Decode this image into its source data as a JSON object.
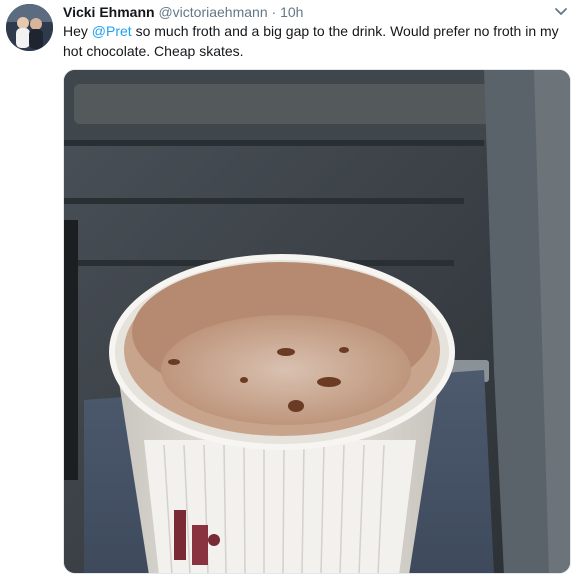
{
  "tweet": {
    "author_name": "Vicki Ehmann",
    "handle": "@victoriaehmann",
    "separator": "·",
    "time": "10h",
    "text_pre": "Hey ",
    "mention": "@Pret",
    "text_post": " so much froth and a big gap to the drink. Would prefer no froth in my hot chocolate. Cheap skates."
  },
  "icons": {
    "caret": "chevron-down-icon",
    "avatar": "avatar"
  },
  "colors": {
    "name": "#14171a",
    "secondary": "#657786",
    "link": "#1da1f2"
  }
}
